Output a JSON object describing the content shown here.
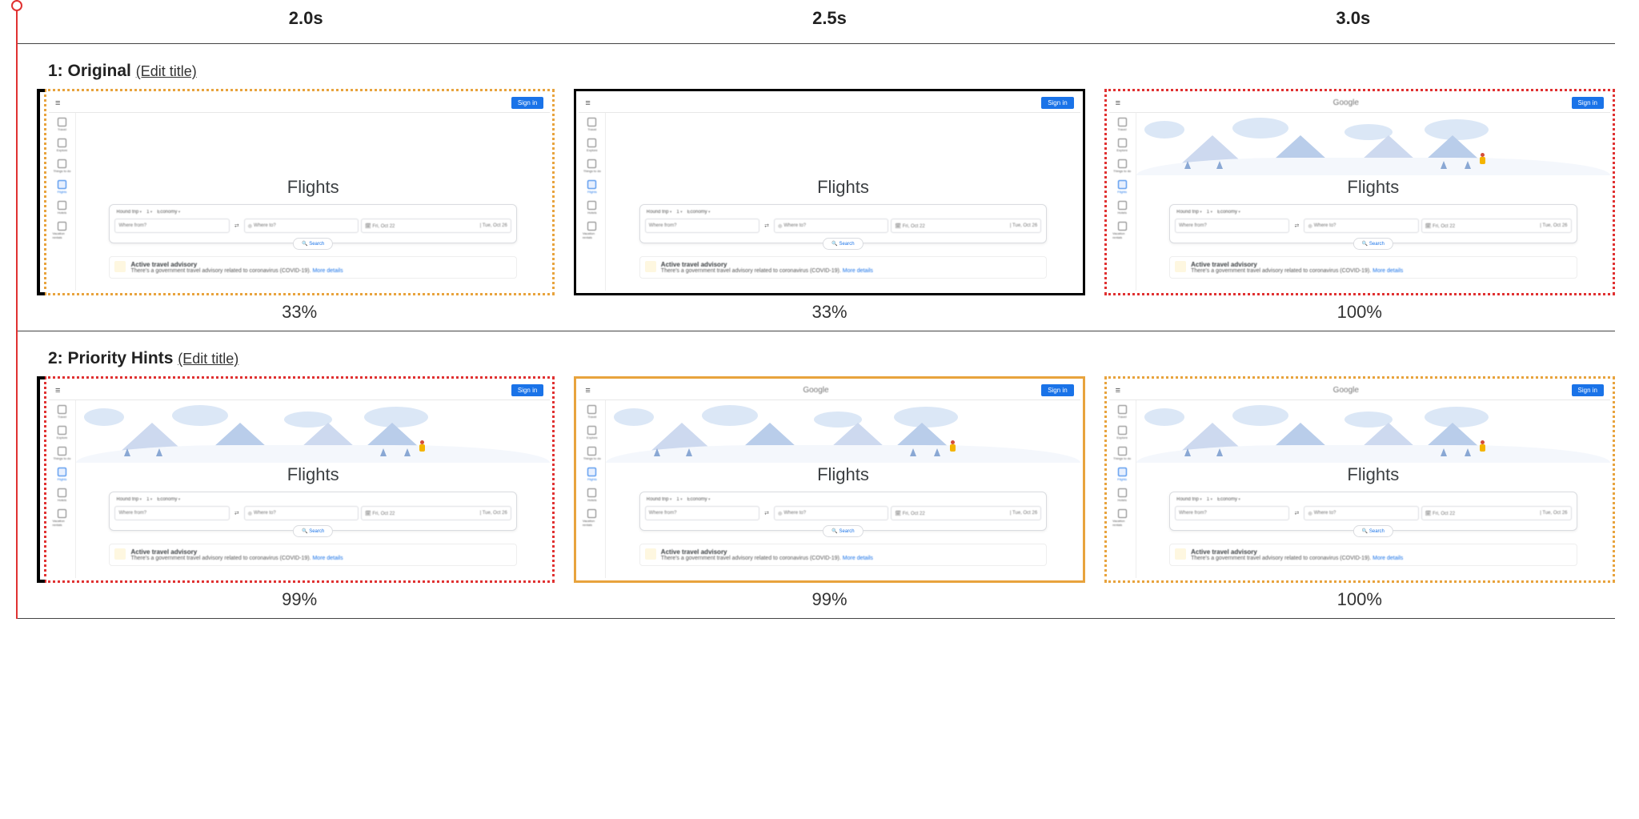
{
  "time_headers": [
    "2.0s",
    "2.5s",
    "3.0s"
  ],
  "edit_title_label": "(Edit title)",
  "tests": [
    {
      "index": "1:",
      "name": "Original",
      "frames": [
        {
          "border": "dotted-yellow",
          "bracket": true,
          "hero_loaded": false,
          "logo_loaded": false,
          "pct": "33%"
        },
        {
          "border": "solid-black",
          "bracket": false,
          "hero_loaded": false,
          "logo_loaded": false,
          "pct": "33%"
        },
        {
          "border": "dotted-red",
          "bracket": false,
          "hero_loaded": true,
          "logo_loaded": true,
          "pct": "100%"
        }
      ]
    },
    {
      "index": "2:",
      "name": "Priority Hints",
      "frames": [
        {
          "border": "dotted-red",
          "bracket": true,
          "hero_loaded": true,
          "logo_loaded": false,
          "pct": "99%"
        },
        {
          "border": "solid-yellow",
          "bracket": false,
          "hero_loaded": true,
          "logo_loaded": true,
          "pct": "99%"
        },
        {
          "border": "dotted-orange",
          "bracket": false,
          "hero_loaded": true,
          "logo_loaded": true,
          "pct": "100%"
        }
      ]
    }
  ],
  "flights": {
    "logo_text": "Google",
    "menu_glyph": "≡",
    "signin_label": "Sign in",
    "title": "Flights",
    "sidebar_items": [
      {
        "label": "Travel"
      },
      {
        "label": "Explore"
      },
      {
        "label": "Things to do"
      },
      {
        "label": "Flights",
        "active": true
      },
      {
        "label": "Hotels"
      },
      {
        "label": "Vacation rentals"
      }
    ],
    "chips": {
      "trip": "Round trip",
      "pax": "1",
      "cabin": "Economy"
    },
    "from_placeholder": "Where from?",
    "to_placeholder": "Where to?",
    "date_out": "Fri, Oct 22",
    "date_back": "Tue, Oct 26",
    "search_label": "Search",
    "advisory_title": "Active travel advisory",
    "advisory_body": "There's a government travel advisory related to coronavirus (COVID-19).",
    "advisory_link": "More details"
  }
}
